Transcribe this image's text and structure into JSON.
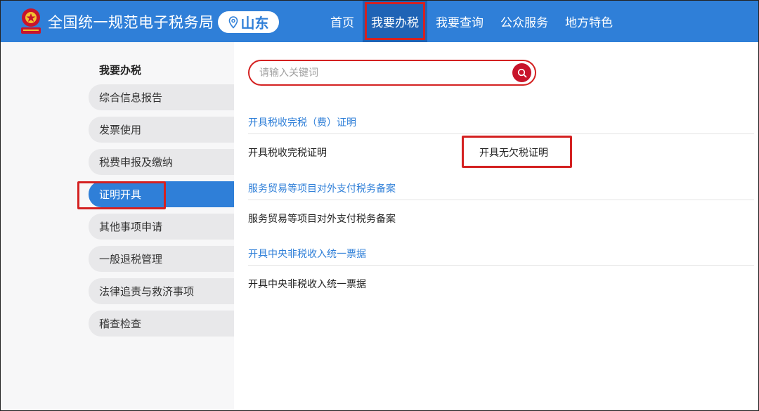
{
  "header": {
    "site_title": "全国统一规范电子税务局",
    "region": "山东",
    "nav": [
      {
        "label": "首页",
        "active": false
      },
      {
        "label": "我要办税",
        "active": true
      },
      {
        "label": "我要查询",
        "active": false
      },
      {
        "label": "公众服务",
        "active": false
      },
      {
        "label": "地方特色",
        "active": false
      }
    ]
  },
  "sidebar": {
    "title": "我要办税",
    "items": [
      {
        "label": "综合信息报告"
      },
      {
        "label": "发票使用"
      },
      {
        "label": "税费申报及缴纳"
      },
      {
        "label": "证明开具",
        "active": true
      },
      {
        "label": "其他事项申请"
      },
      {
        "label": "一般退税管理"
      },
      {
        "label": "法律追责与救济事项"
      },
      {
        "label": "稽查检查"
      }
    ]
  },
  "search": {
    "placeholder": "请输入关键词",
    "value": ""
  },
  "sections": [
    {
      "heading": "开具税收完税（费）证明",
      "items": [
        "开具税收完税证明",
        "开具无欠税证明"
      ]
    },
    {
      "heading": "服务贸易等项目对外支付税务备案",
      "items": [
        "服务贸易等项目对外支付税务备案"
      ]
    },
    {
      "heading": "开具中央非税收入统一票据",
      "items": [
        "开具中央非税收入统一票据"
      ]
    }
  ],
  "colors": {
    "brand_blue": "#2f7fd8",
    "active_nav": "#1f63b5",
    "highlight_red": "#d42121",
    "search_button": "#c8142b"
  }
}
